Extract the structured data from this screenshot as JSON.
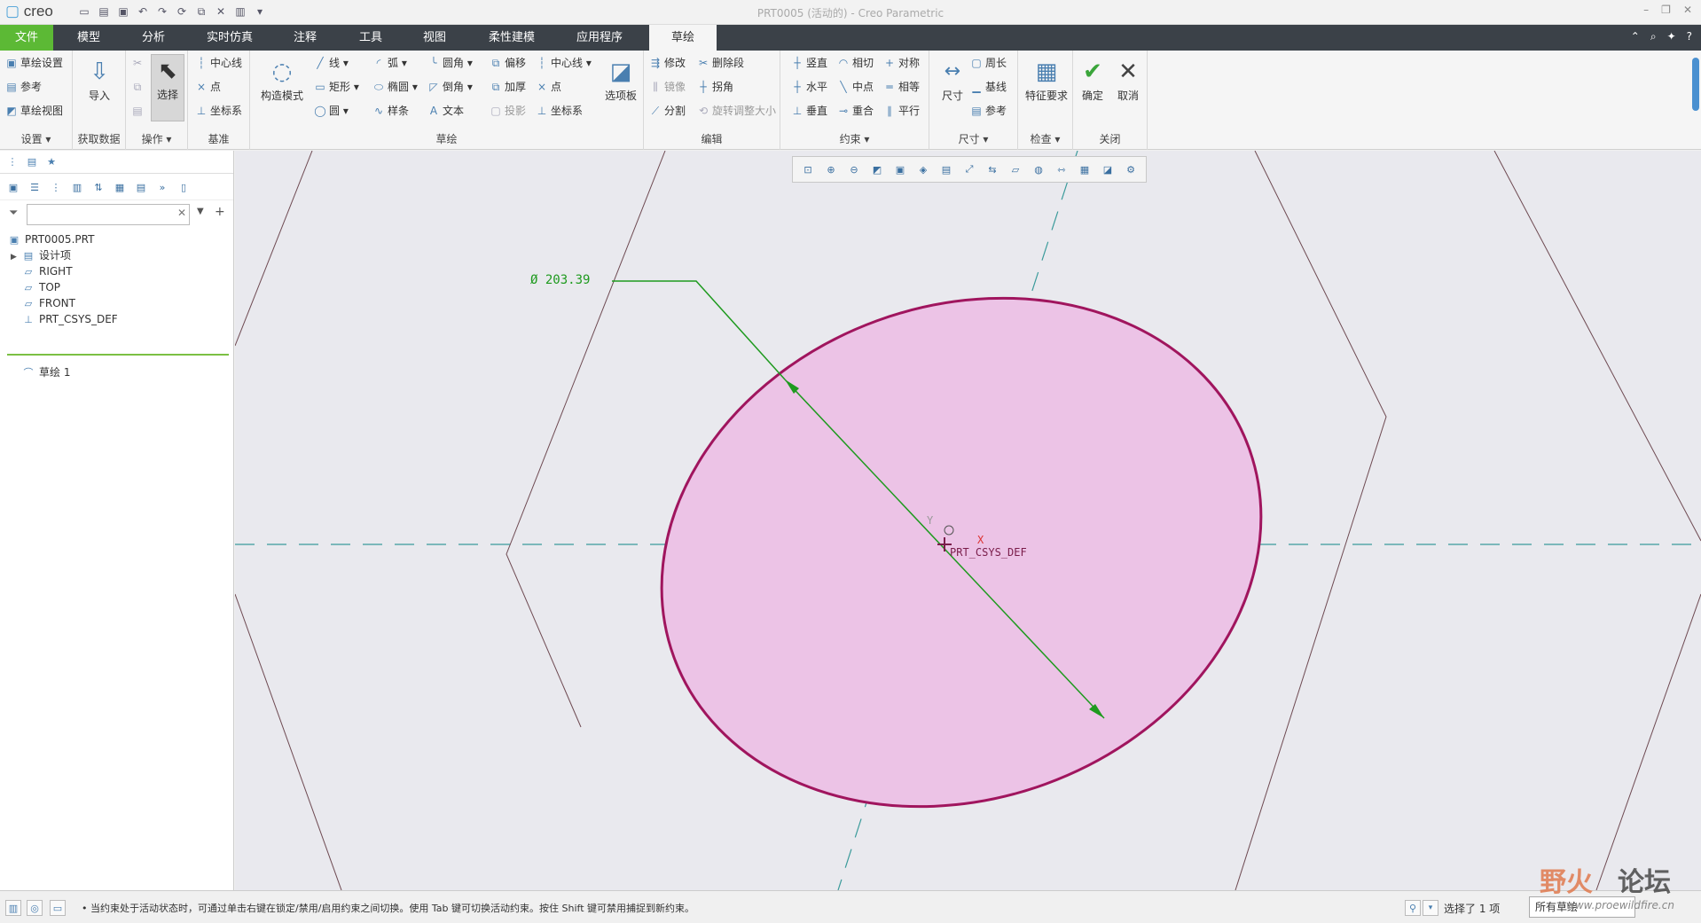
{
  "app": {
    "logo_text": "creo",
    "window_title": "PRT0005 (活动的) - Creo Parametric"
  },
  "menu": {
    "tabs": [
      "文件",
      "模型",
      "分析",
      "实时仿真",
      "注释",
      "工具",
      "视图",
      "柔性建模",
      "应用程序",
      "草绘"
    ],
    "active_tab": "草绘"
  },
  "ribbon": {
    "settings": {
      "label": "设置",
      "items": [
        "草绘设置",
        "参考",
        "草绘视图"
      ]
    },
    "getdata": {
      "label": "获取数据",
      "import": "导入"
    },
    "operations": {
      "label": "操作",
      "select": "选择"
    },
    "datum": {
      "label": "基准",
      "items": [
        "中心线",
        "点",
        "坐标系"
      ]
    },
    "sketch": {
      "label": "草绘",
      "construct": "构造模式",
      "col1": [
        "线",
        "矩形",
        "圆"
      ],
      "col2": [
        "弧",
        "椭圆",
        "样条"
      ],
      "col3": [
        "圆角",
        "倒角",
        "文本"
      ],
      "col4": [
        "偏移",
        "加厚",
        "投影"
      ],
      "col5": [
        "中心线",
        "点",
        "坐标系"
      ],
      "palette": "选项板"
    },
    "edit": {
      "label": "编辑",
      "items": [
        "修改",
        "删除段",
        "镜像",
        "拐角",
        "分割",
        "旋转调整大小"
      ]
    },
    "constrain": {
      "label": "约束",
      "items": [
        "竖直",
        "相切",
        "对称",
        "水平",
        "中点",
        "相等",
        "垂直",
        "重合",
        "平行"
      ]
    },
    "dimension": {
      "label": "尺寸",
      "big": "尺寸",
      "items": [
        "周长",
        "基线",
        "参考"
      ]
    },
    "inspect": {
      "label": "检查",
      "big": "特征要求"
    },
    "close": {
      "label": "关闭",
      "ok": "确定",
      "cancel": "取消"
    }
  },
  "model_tree": {
    "search_placeholder": "",
    "items": [
      {
        "label": "PRT0005.PRT",
        "icon": "part-icon"
      },
      {
        "label": "设计项",
        "icon": "design-items-icon"
      },
      {
        "label": "RIGHT",
        "icon": "datum-plane-icon"
      },
      {
        "label": "TOP",
        "icon": "datum-plane-icon"
      },
      {
        "label": "FRONT",
        "icon": "datum-plane-icon"
      },
      {
        "label": "PRT_CSYS_DEF",
        "icon": "csys-icon"
      },
      {
        "label": "草绘 1",
        "icon": "sketch-icon"
      }
    ]
  },
  "sketch": {
    "dimension_text": "Ø 203.39",
    "csys_label": "PRT_CSYS_DEF",
    "axis_x": "X",
    "axis_y": "Y",
    "fill_color": "#ecc3e6",
    "outline_color": "#a0155e",
    "dimension_color": "#1e9a1e"
  },
  "status": {
    "message": "• 当约束处于活动状态时，可通过单击右键在锁定/禁用/启用约束之间切换。使用 Tab 键可切换活动约束。按住 Shift 键可禁用捕捉到新约束。",
    "selected": "选择了 1 项",
    "filter": "所有草绘"
  },
  "watermark": {
    "text1": "野火",
    "text2": "论坛",
    "url": "www.proewildfire.cn"
  }
}
